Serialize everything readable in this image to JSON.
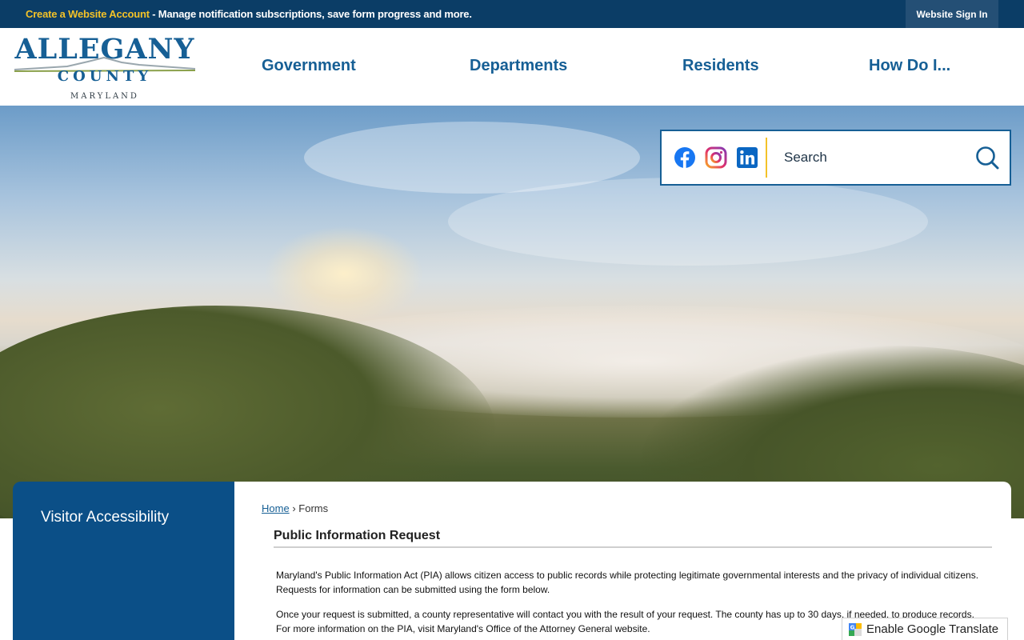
{
  "topbar": {
    "account_link": "Create a Website Account",
    "message": " - Manage notification subscriptions, save form progress and more.",
    "signin_label": "Website Sign In"
  },
  "logo": {
    "main": "ALLEGANY",
    "sub": "COUNTY",
    "state": "MARYLAND"
  },
  "nav": {
    "items": [
      "Government",
      "Departments",
      "Residents",
      "How Do I..."
    ]
  },
  "social": {
    "icons": [
      "facebook-icon",
      "instagram-icon",
      "linkedin-icon"
    ],
    "search_placeholder": "Search"
  },
  "sidebar": {
    "items": [
      "Visitor Accessibility"
    ]
  },
  "breadcrumb": {
    "home": "Home",
    "separator": "›",
    "current": "Forms"
  },
  "main": {
    "title": "Public Information Request",
    "paragraphs": [
      "Maryland's Public Information Act (PIA) allows citizen access to public records while protecting legitimate governmental interests and the privacy of individual citizens. Requests for information can be submitted using the form below.",
      "Once your request is submitted, a county representative will contact you with the result of your request. The county has up to 30 days, if needed, to produce records. For more information on the PIA, visit Maryland's Office of the Attorney General website."
    ]
  },
  "translate": {
    "label": "Enable Google Translate"
  },
  "colors": {
    "brand_blue": "#165f95",
    "topbar_bg": "#0b3d66",
    "accent_yellow": "#f3c228",
    "sidebar_bg": "#0b4f87"
  }
}
